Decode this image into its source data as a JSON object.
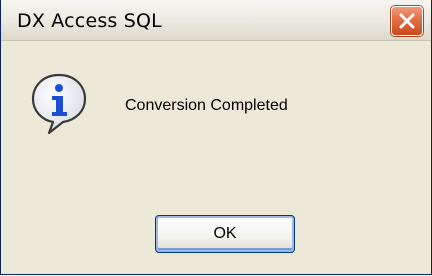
{
  "window": {
    "title": "DX Access SQL"
  },
  "dialog": {
    "icon": "information-icon",
    "message": "Conversion Completed",
    "ok_label": "OK"
  },
  "colors": {
    "dialog_bg": "#ece9d8",
    "close_button": "#e26d44",
    "info_icon_fill": "#1a4fd6"
  }
}
